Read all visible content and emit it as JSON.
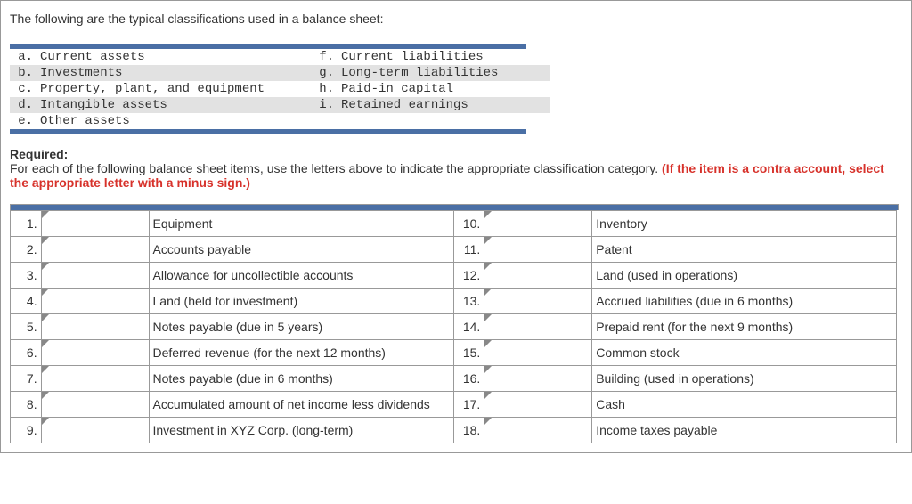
{
  "intro_text": "The following are the typical classifications used in a balance sheet:",
  "classifications_left": [
    {
      "letter": "a.",
      "desc": "Current assets"
    },
    {
      "letter": "b.",
      "desc": "Investments"
    },
    {
      "letter": "c.",
      "desc": "Property, plant, and equipment"
    },
    {
      "letter": "d.",
      "desc": "Intangible assets"
    },
    {
      "letter": "e.",
      "desc": "Other assets"
    }
  ],
  "classifications_right": [
    {
      "letter": "f.",
      "desc": "Current liabilities"
    },
    {
      "letter": "g.",
      "desc": "Long-term liabilities"
    },
    {
      "letter": "h.",
      "desc": "Paid-in capital"
    },
    {
      "letter": "i.",
      "desc": "Retained earnings"
    },
    {
      "letter": "",
      "desc": ""
    }
  ],
  "required_label": "Required:",
  "required_text": "For each of the following balance sheet items, use the letters above to indicate the appropriate classification category. ",
  "required_note": "(If the item is a contra account, select the appropriate letter with a minus sign.)",
  "items_left": [
    {
      "num": "1.",
      "item": "Equipment"
    },
    {
      "num": "2.",
      "item": "Accounts payable"
    },
    {
      "num": "3.",
      "item": "Allowance for uncollectible accounts"
    },
    {
      "num": "4.",
      "item": "Land (held for investment)"
    },
    {
      "num": "5.",
      "item": "Notes payable (due in 5 years)"
    },
    {
      "num": "6.",
      "item": "Deferred revenue (for the next 12 months)"
    },
    {
      "num": "7.",
      "item": "Notes payable (due in 6 months)"
    },
    {
      "num": "8.",
      "item": "Accumulated amount of net income less dividends"
    },
    {
      "num": "9.",
      "item": "Investment in XYZ Corp. (long-term)"
    }
  ],
  "items_right": [
    {
      "num": "10.",
      "item": "Inventory"
    },
    {
      "num": "11.",
      "item": "Patent"
    },
    {
      "num": "12.",
      "item": "Land (used in operations)"
    },
    {
      "num": "13.",
      "item": "Accrued liabilities (due in 6 months)"
    },
    {
      "num": "14.",
      "item": "Prepaid rent (for the next 9 months)"
    },
    {
      "num": "15.",
      "item": "Common stock"
    },
    {
      "num": "16.",
      "item": "Building (used in operations)"
    },
    {
      "num": "17.",
      "item": "Cash"
    },
    {
      "num": "18.",
      "item": "Income taxes payable"
    }
  ]
}
